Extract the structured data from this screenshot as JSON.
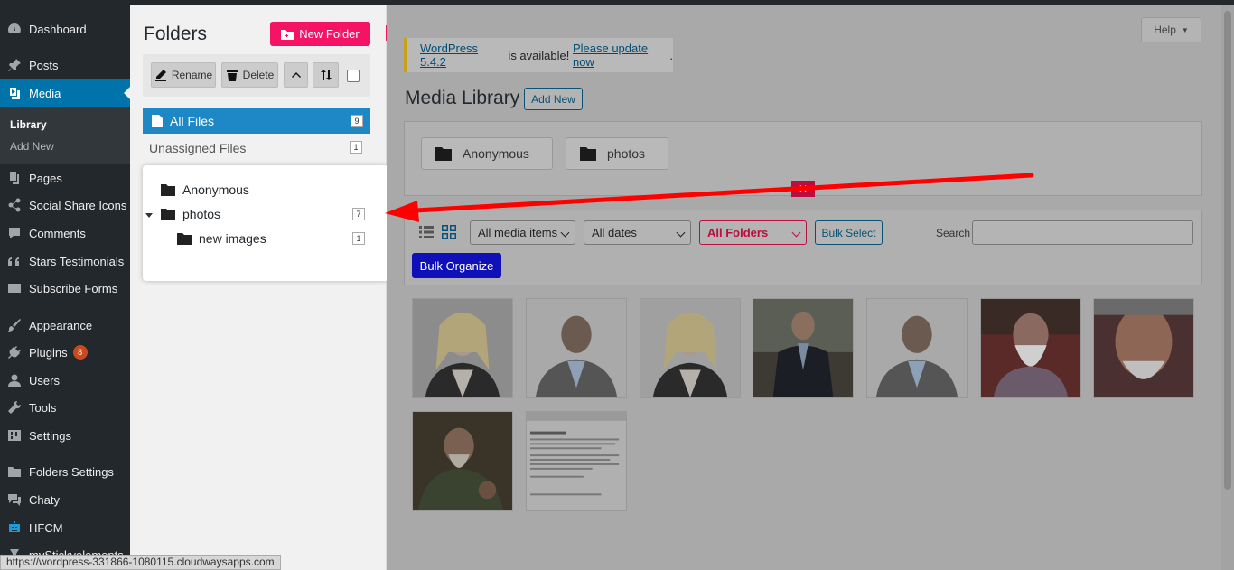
{
  "nav": {
    "items": [
      {
        "label": "Dashboard",
        "icon": "dashboard-icon"
      },
      {
        "label": "Posts",
        "icon": "pin-icon"
      },
      {
        "label": "Media",
        "icon": "media-icon"
      },
      {
        "label": "Pages",
        "icon": "page-icon"
      },
      {
        "label": "Social Share Icons",
        "icon": "share-icon"
      },
      {
        "label": "Comments",
        "icon": "comment-icon"
      },
      {
        "label": "Stars Testimonials",
        "icon": "quote-icon"
      },
      {
        "label": "Subscribe Forms",
        "icon": "mail-icon"
      },
      {
        "label": "Appearance",
        "icon": "brush-icon"
      },
      {
        "label": "Plugins",
        "icon": "plug-icon"
      },
      {
        "label": "Users",
        "icon": "user-icon"
      },
      {
        "label": "Tools",
        "icon": "wrench-icon"
      },
      {
        "label": "Settings",
        "icon": "sliders-icon"
      },
      {
        "label": "Folders Settings",
        "icon": "folder-icon"
      },
      {
        "label": "Chaty",
        "icon": "chat-icon"
      },
      {
        "label": "HFCM",
        "icon": "robot-icon"
      },
      {
        "label": "myStickyelements",
        "icon": "sticky-icon"
      }
    ],
    "sub": {
      "library": "Library",
      "add_new": "Add New"
    },
    "plugins_badge": "8"
  },
  "folders": {
    "title": "Folders",
    "new_folder": "New Folder",
    "rename": "Rename",
    "delete": "Delete",
    "all_files": "All Files",
    "all_files_count": "9",
    "unassigned": "Unassigned Files",
    "unassigned_count": "1",
    "tree": [
      {
        "label": "Anonymous",
        "count": ""
      },
      {
        "label": "photos",
        "count": "7"
      },
      {
        "label": "new images",
        "count": "1"
      }
    ]
  },
  "main": {
    "help": "Help",
    "notice_link1": "WordPress 5.4.2",
    "notice_text": " is available! ",
    "notice_link2": "Please update now",
    "notice_end": ".",
    "title": "Media Library",
    "add_new": "Add New",
    "chips": [
      "Anonymous",
      "photos"
    ],
    "filters": {
      "media": "All media items",
      "dates": "All dates",
      "folders": "All Folders",
      "bulk_select": "Bulk Select",
      "search_label": "Search",
      "bulk_organize": "Bulk Organize"
    }
  },
  "status_url": "https://wordpress-331866-1080115.cloudwaysapps.com",
  "colors": {
    "accent": "#f51366",
    "wp_blue": "#0073aa",
    "arrow": "#ff0000"
  }
}
